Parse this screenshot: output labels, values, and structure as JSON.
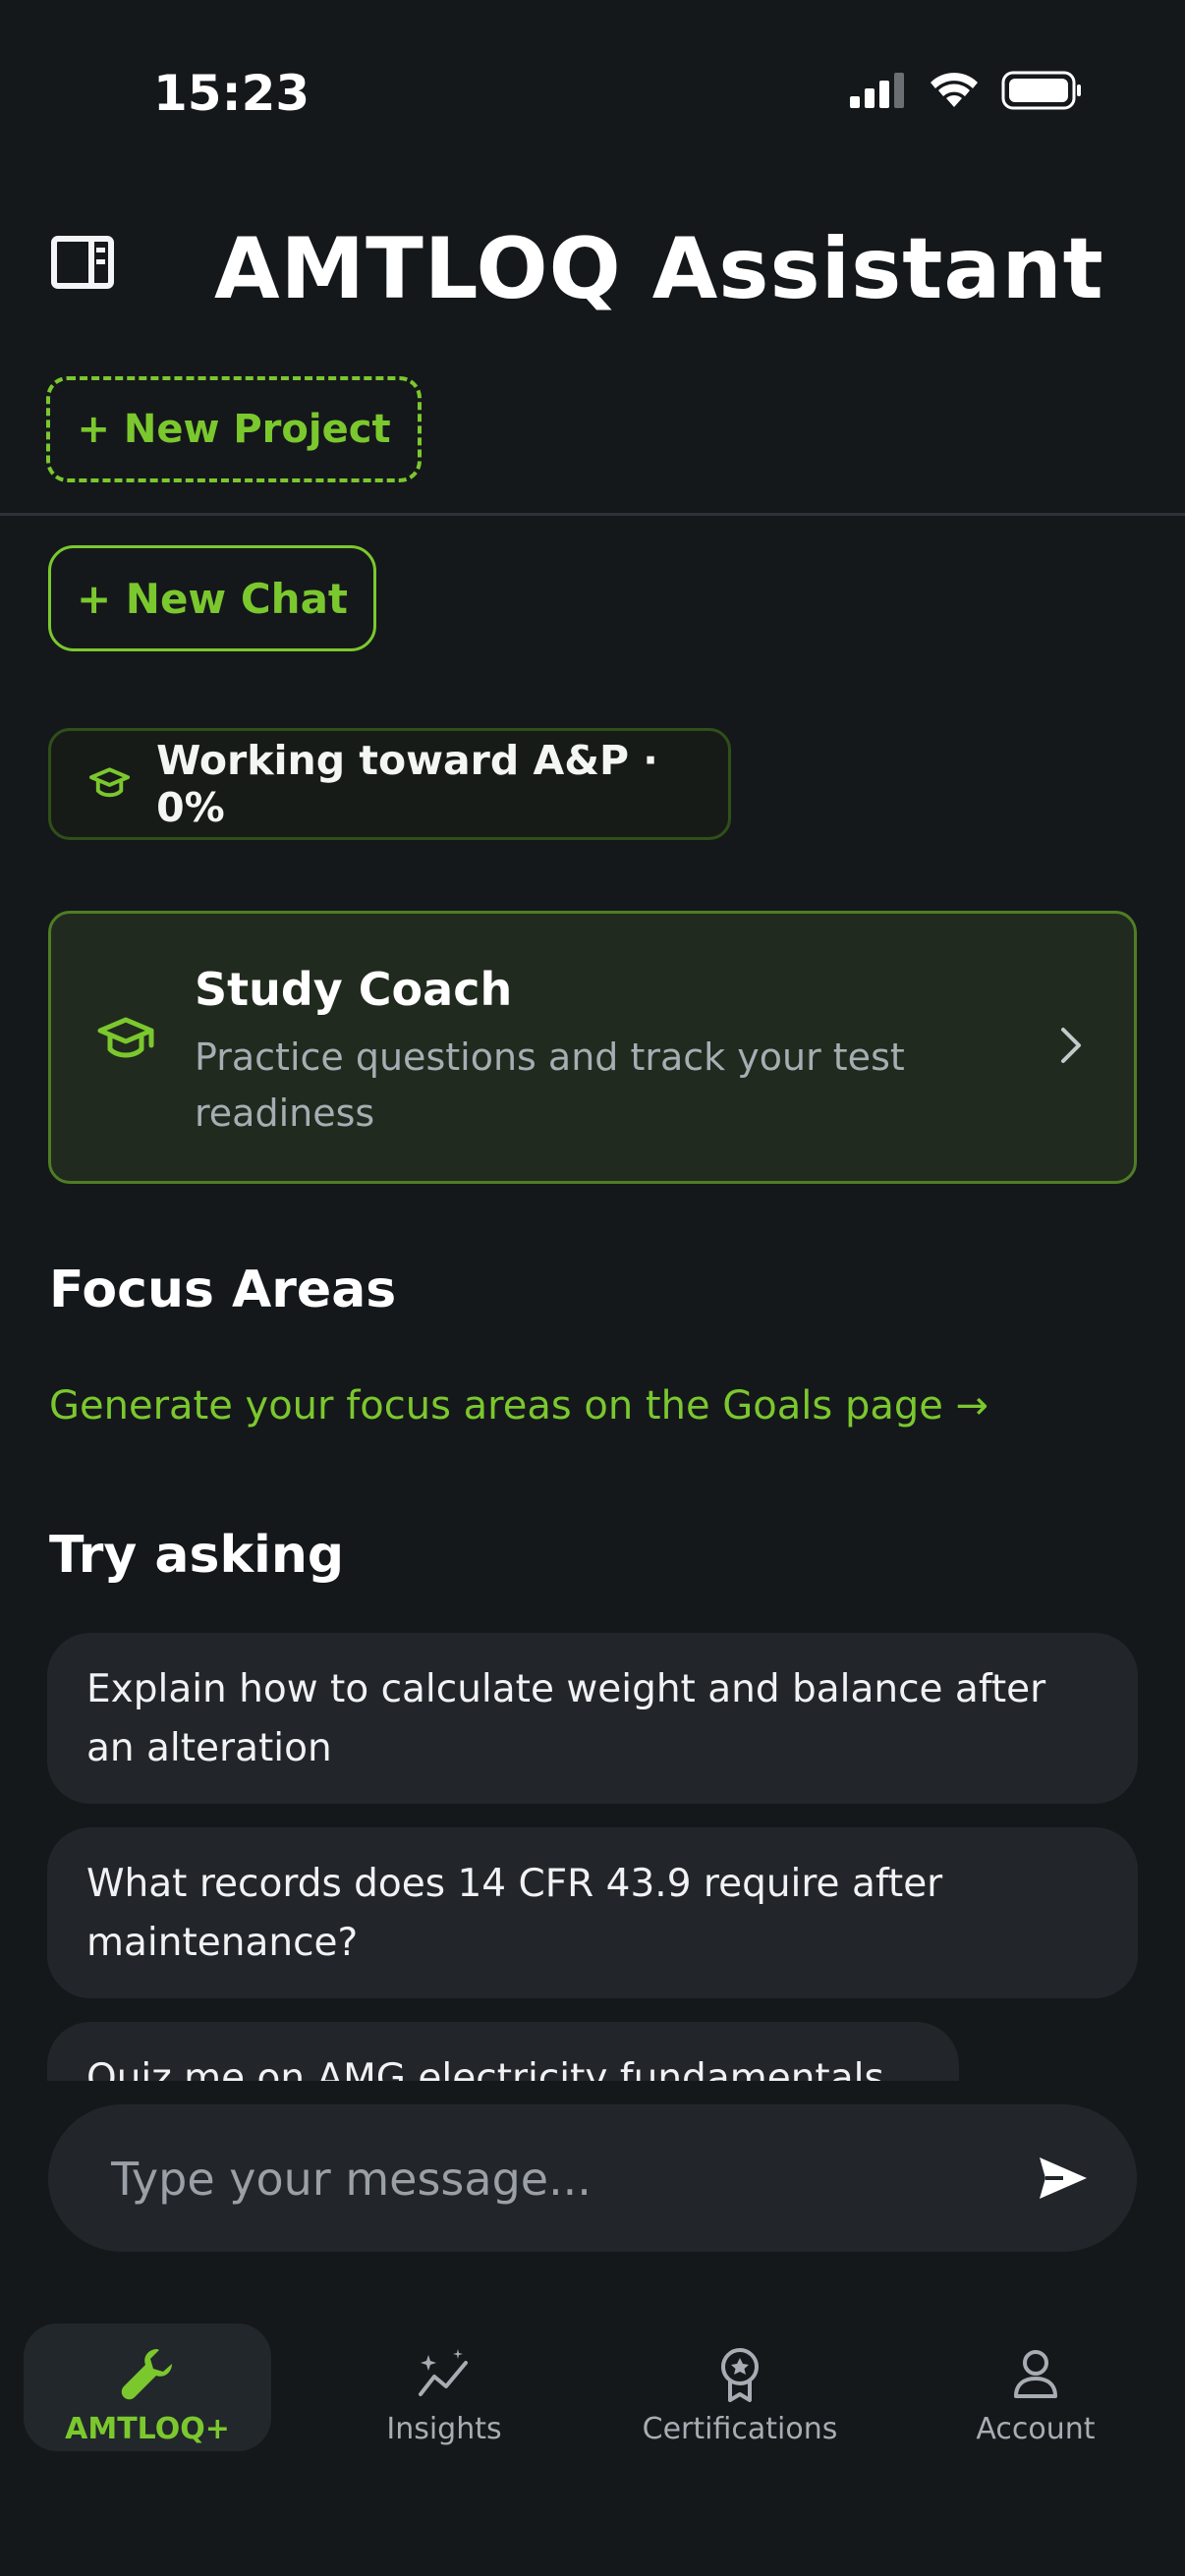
{
  "status_bar": {
    "time": "15:23"
  },
  "header": {
    "title": "AMTLOQ Assistant"
  },
  "buttons": {
    "new_project": "+ New Project",
    "new_chat": "+ New Chat"
  },
  "progress_chip": {
    "text": "Working toward A&P · 0%",
    "value_percent": 0
  },
  "study_coach": {
    "title": "Study Coach",
    "description": "Practice questions and track your test readiness"
  },
  "focus_areas": {
    "title": "Focus Areas",
    "link": "Generate your focus areas on the Goals page →"
  },
  "try_asking": {
    "title": "Try asking",
    "suggestions": [
      "Explain how to calculate weight and balance after an alteration",
      "What records does 14 CFR 43.9 require after maintenance?",
      "Quiz me on AMG electricity fundamentals"
    ]
  },
  "composer": {
    "placeholder": "Type your message..."
  },
  "tabs": [
    {
      "label": "AMTLOQ+",
      "icon": "wrench-icon",
      "active": true
    },
    {
      "label": "Insights",
      "icon": "insights-icon",
      "active": false
    },
    {
      "label": "Certifications",
      "icon": "award-icon",
      "active": false
    },
    {
      "label": "Account",
      "icon": "user-icon",
      "active": false
    }
  ],
  "colors": {
    "accent": "#7bc82e",
    "background": "#15181b",
    "surface": "#22262b"
  }
}
